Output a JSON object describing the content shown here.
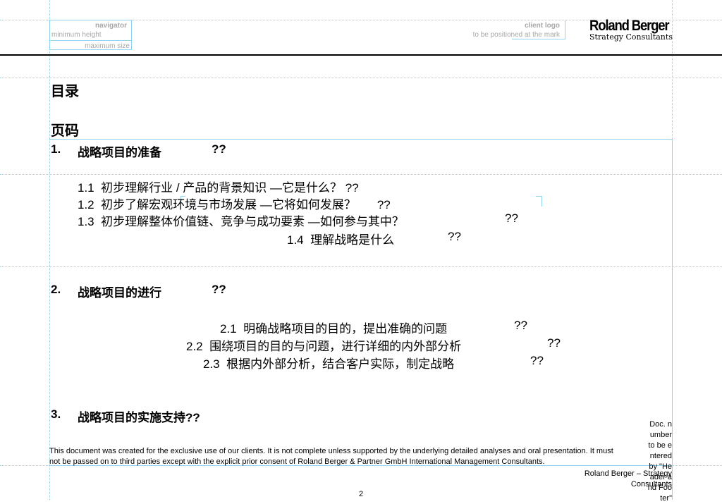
{
  "header": {
    "navigator": {
      "title": "navigator",
      "min_label": "minimum height",
      "max_label": "maximum size"
    },
    "client_logo": {
      "title": "client logo",
      "note": "to be positioned at the mark"
    },
    "brand": {
      "name": "Roland Berger",
      "tagline": "Strategy Consultants"
    }
  },
  "toc": {
    "title": "目录",
    "page_label": "页码",
    "sections": [
      {
        "num": "1.",
        "title": "战略项目的准备",
        "page": "??",
        "items": [
          {
            "num": "1.1",
            "title": "初步理解行业 / 产品的背景知识  —它是什么？",
            "page": "??"
          },
          {
            "num": "1.2",
            "title": "初步了解宏观环境与市场发展  —它将如何发展？",
            "page": "??"
          },
          {
            "num": "1.3",
            "title": "初步理解整体价值链、竞争与成功要素  —如何参与其中？",
            "page": "??"
          },
          {
            "num": "1.4",
            "title": "理解战略是什么",
            "page": "??"
          }
        ]
      },
      {
        "num": "2.",
        "title": "战略项目的进行",
        "page": "??",
        "items": [
          {
            "num": "2.1",
            "title": "明确战略项目的目的，提出准确的问题",
            "page": "??"
          },
          {
            "num": "2.2",
            "title": "围绕项目的目的与问题，进行详细的内外部分析",
            "page": "??"
          },
          {
            "num": "2.3",
            "title": "根据内外部分析，结合客户实际，制定战略",
            "page": "??"
          }
        ]
      },
      {
        "num": "3.",
        "title": "战略项目的实施支持",
        "page": "??"
      }
    ]
  },
  "footer": {
    "disclaimer_1": "This document was created for the exclusive use of our clients. It is not complete unless supported by the underlying detailed analyses and oral presentation. It must",
    "disclaimer_2": "not be passed on to third parties except with the explicit prior consent of Roland Berger & Partner GmbH International Management Consultants.",
    "company": "Roland Berger – Strategy Consultants",
    "doc_number": "Doc. number to be entered by \"Header and Footer\"",
    "page_number": "2"
  }
}
